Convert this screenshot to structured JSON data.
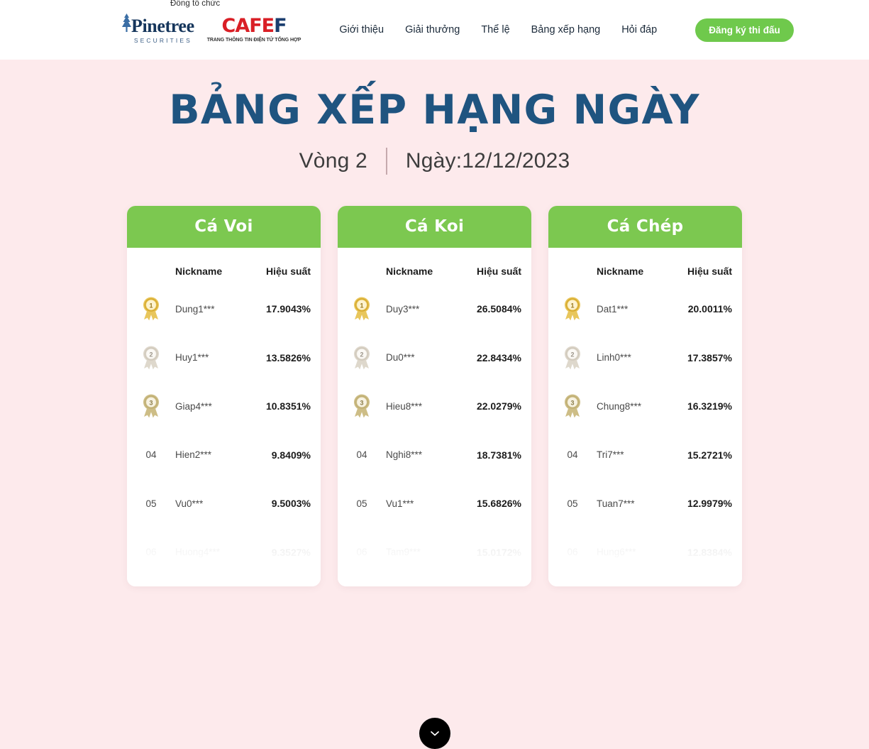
{
  "header": {
    "co_organizer_label": "Đồng tổ chức",
    "logos": {
      "pinetree": {
        "name": "Pinetree",
        "tagline": "SECURITIES"
      },
      "cafef": {
        "name_red": "CAFE",
        "name_navy": "F",
        "tagline": "TRANG THÔNG TIN ĐIỆN TỬ TỔNG HỢP"
      }
    },
    "nav": [
      {
        "label": "Giới thiệu"
      },
      {
        "label": "Giải thưởng"
      },
      {
        "label": "Thể lệ"
      },
      {
        "label": "Bảng xếp hạng"
      },
      {
        "label": "Hỏi đáp"
      }
    ],
    "cta_label": "Đăng ký thi đấu"
  },
  "hero": {
    "title": "BẢNG XẾP HẠNG NGÀY",
    "round": "Vòng 2",
    "date": "Ngày:12/12/2023"
  },
  "table_headers": {
    "nickname": "Nickname",
    "performance": "Hiệu suất"
  },
  "boards": [
    {
      "title": "Cá Voi",
      "rows": [
        {
          "rank": "01",
          "medal": "gold-medal-icon",
          "nickname": "Dung1***",
          "performance": "17.9043%",
          "faded": false
        },
        {
          "rank": "02",
          "medal": "silver-medal-icon",
          "nickname": "Huy1***",
          "performance": "13.5826%",
          "faded": false
        },
        {
          "rank": "03",
          "medal": "bronze-medal-icon",
          "nickname": "Giap4***",
          "performance": "10.8351%",
          "faded": false
        },
        {
          "rank": "04",
          "medal": "",
          "nickname": "Hien2***",
          "performance": "9.8409%",
          "faded": false
        },
        {
          "rank": "05",
          "medal": "",
          "nickname": "Vu0***",
          "performance": "9.5003%",
          "faded": false
        },
        {
          "rank": "06",
          "medal": "",
          "nickname": "Huong4***",
          "performance": "9.3527%",
          "faded": true
        }
      ]
    },
    {
      "title": "Cá Koi",
      "rows": [
        {
          "rank": "01",
          "medal": "gold-medal-icon",
          "nickname": "Duy3***",
          "performance": "26.5084%",
          "faded": false
        },
        {
          "rank": "02",
          "medal": "silver-medal-icon",
          "nickname": "Du0***",
          "performance": "22.8434%",
          "faded": false
        },
        {
          "rank": "03",
          "medal": "bronze-medal-icon",
          "nickname": "Hieu8***",
          "performance": "22.0279%",
          "faded": false
        },
        {
          "rank": "04",
          "medal": "",
          "nickname": "Nghi8***",
          "performance": "18.7381%",
          "faded": false
        },
        {
          "rank": "05",
          "medal": "",
          "nickname": "Vu1***",
          "performance": "15.6826%",
          "faded": false
        },
        {
          "rank": "06",
          "medal": "",
          "nickname": "Tam9***",
          "performance": "15.0172%",
          "faded": true
        }
      ]
    },
    {
      "title": "Cá Chép",
      "rows": [
        {
          "rank": "01",
          "medal": "gold-medal-icon",
          "nickname": "Dat1***",
          "performance": "20.0011%",
          "faded": false
        },
        {
          "rank": "02",
          "medal": "silver-medal-icon",
          "nickname": "Linh0***",
          "performance": "17.3857%",
          "faded": false
        },
        {
          "rank": "03",
          "medal": "bronze-medal-icon",
          "nickname": "Chung8***",
          "performance": "16.3219%",
          "faded": false
        },
        {
          "rank": "04",
          "medal": "",
          "nickname": "Tri7***",
          "performance": "15.2721%",
          "faded": false
        },
        {
          "rank": "05",
          "medal": "",
          "nickname": "Tuan7***",
          "performance": "12.9979%",
          "faded": false
        },
        {
          "rank": "06",
          "medal": "",
          "nickname": "Hung6***",
          "performance": "12.8384%",
          "faded": true
        }
      ]
    }
  ],
  "scroll_button": {
    "icon": "chevron-down-icon"
  },
  "colors": {
    "background": "#fdeaec",
    "title_navy": "#1f5480",
    "accent_green": "#7cc850",
    "cta_green": "#6fc94c",
    "card_white": "#ffffff",
    "cafef_red": "#d91f26",
    "scroll_button": "#000000"
  }
}
